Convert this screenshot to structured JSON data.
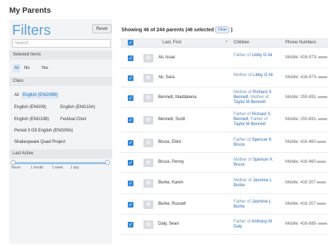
{
  "page": {
    "title": "My Parents"
  },
  "filters": {
    "heading": "Filters",
    "reset_label": "Reset",
    "search_placeholder": "Search",
    "selected_items": {
      "label": "Selected Items",
      "options": [
        "All",
        "No",
        "Yes"
      ],
      "selected": "All"
    },
    "class": {
      "label": "Class",
      "options": [
        "All",
        "English (ENG09B)",
        "English (ENG09)",
        "English (ENG10A)",
        "English (ENG10B)",
        "Festival Choir",
        "Period 3 G9 English (ENG09A)",
        "Shakespeare Quad Project"
      ],
      "selected": "English (ENG09B)"
    },
    "last_active": {
      "label": "Last Active",
      "ticks": [
        "Never",
        "1 month",
        "1 week",
        "1 day"
      ],
      "range": [
        0,
        1
      ]
    }
  },
  "summary": {
    "text": "Showing 46 of 244 parents (46 selected",
    "clear_label": "Clear",
    "close_paren": ")"
  },
  "table": {
    "columns": {
      "name": "Last, First",
      "children": "Children",
      "phone": "Phone Numbers"
    },
    "sort_indicator": "^",
    "rows": [
      {
        "name": "Ali, Issac",
        "relation": "Father of",
        "child": "Libby O Ali",
        "phone": "Mobile: 416-973-"
      },
      {
        "name": "Ali, Sara",
        "relation": "Mother of",
        "child": "Libby O Ali",
        "phone": "Mobile: 416-973-"
      },
      {
        "name": "Bennett, Maddalena",
        "relation": "Mother of",
        "child": "Richard S Bennett",
        "relation2": ", Mother of",
        "child2": "Taylor M Bennett",
        "phone": "Mobile: 250-891-"
      },
      {
        "name": "Bennett, Scott",
        "relation": "Father of",
        "child": "Richard S Bennett",
        "relation2": ", Father of",
        "child2": "Taylor M Bennett",
        "phone": "Mobile: 250-891-"
      },
      {
        "name": "Bruce, Elliot",
        "relation": "Father of",
        "child": "Spencer K Bruce",
        "phone": "Mobile: 416 460"
      },
      {
        "name": "Bruce, Penny",
        "relation": "Mother of",
        "child": "Spencer K Bruce",
        "phone": "Mobile: 416 460"
      },
      {
        "name": "Burke, Karen",
        "relation": "Mother of",
        "child": "Jasmine L Burke",
        "phone": "Mobile: 416 207"
      },
      {
        "name": "Burke, Russell",
        "relation": "Father of",
        "child": "Jasmine L Burke",
        "phone": "Mobile: 416 207"
      },
      {
        "name": "Daly, Sean",
        "relation": "Father of",
        "child": "Anthony M Daly",
        "phone": "Mobile: 416-885-"
      }
    ]
  }
}
